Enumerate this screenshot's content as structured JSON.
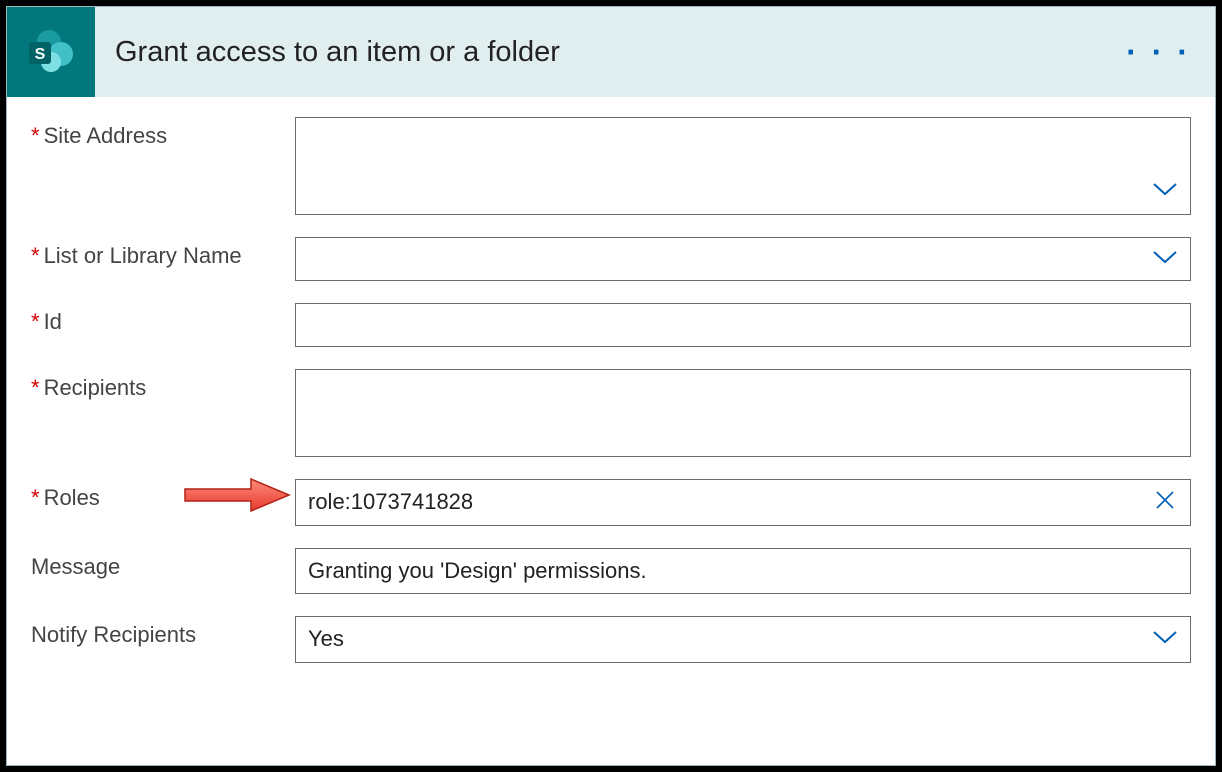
{
  "header": {
    "title": "Grant access to an item or a folder"
  },
  "fields": {
    "siteAddress": {
      "label": "Site Address",
      "required": true,
      "value": "",
      "control": "dropdown-tall"
    },
    "listName": {
      "label": "List or Library Name",
      "required": true,
      "value": "",
      "control": "dropdown"
    },
    "id": {
      "label": "Id",
      "required": true,
      "value": "",
      "control": "text"
    },
    "recipients": {
      "label": "Recipients",
      "required": true,
      "value": "",
      "control": "textarea"
    },
    "roles": {
      "label": "Roles",
      "required": true,
      "value": "role:1073741828",
      "control": "clearable"
    },
    "message": {
      "label": "Message",
      "required": false,
      "value": "Granting you 'Design' permissions.",
      "control": "text"
    },
    "notify": {
      "label": "Notify Recipients",
      "required": false,
      "value": "Yes",
      "control": "dropdown"
    }
  }
}
